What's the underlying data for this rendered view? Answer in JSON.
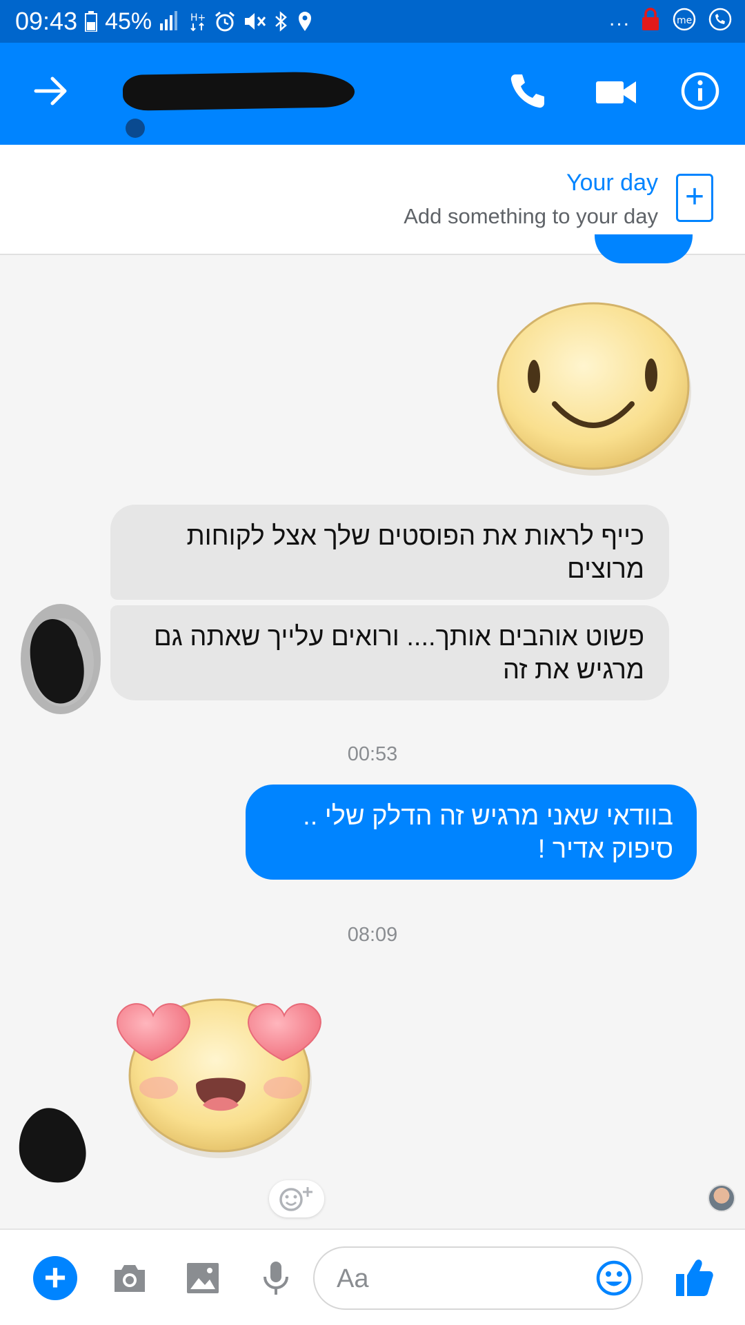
{
  "status_bar": {
    "time": "09:43",
    "battery": "45%",
    "overflow": "...",
    "icons": [
      "battery-icon",
      "signal-icon",
      "data-icon",
      "alarm-icon",
      "mute-icon",
      "bluetooth-icon",
      "location-icon",
      "lock-icon",
      "app-icon",
      "wifi-call-icon"
    ]
  },
  "header": {
    "contact_name": "",
    "icons": [
      "back-arrow-icon",
      "phone-icon",
      "video-camera-icon",
      "info-icon"
    ],
    "accent": "#0084ff"
  },
  "your_day": {
    "title": "Your day",
    "subtitle": "Add something to your day",
    "add_symbol": "+"
  },
  "messages": {
    "incoming_1": "כייף לראות את הפוסטים שלך אצל לקוחות מרוצים",
    "incoming_2": "פשוט אוהבים אותך.... ורואים עלייך שאתה גם מרגיש את זה",
    "timestamp_1": "00:53",
    "outgoing_1_line1": "בוודאי שאני מרגיש זה הדלק שלי ..",
    "outgoing_1_line2": "סיפוק אדיר !",
    "timestamp_2": "08:09",
    "stickers": [
      "smile-sticker",
      "heart-eyes-sticker"
    ]
  },
  "composer": {
    "placeholder": "Aa",
    "icons": [
      "plus-icon",
      "camera-icon",
      "image-icon",
      "microphone-icon",
      "emoji-icon",
      "thumbs-up-icon"
    ],
    "plus_symbol": "+"
  },
  "colors": {
    "status_bar": "#0066cc",
    "app_bar": "#0084ff",
    "incoming_bubble": "#e6e6e6",
    "outgoing_bubble": "#0084ff",
    "background": "#f5f5f5"
  }
}
